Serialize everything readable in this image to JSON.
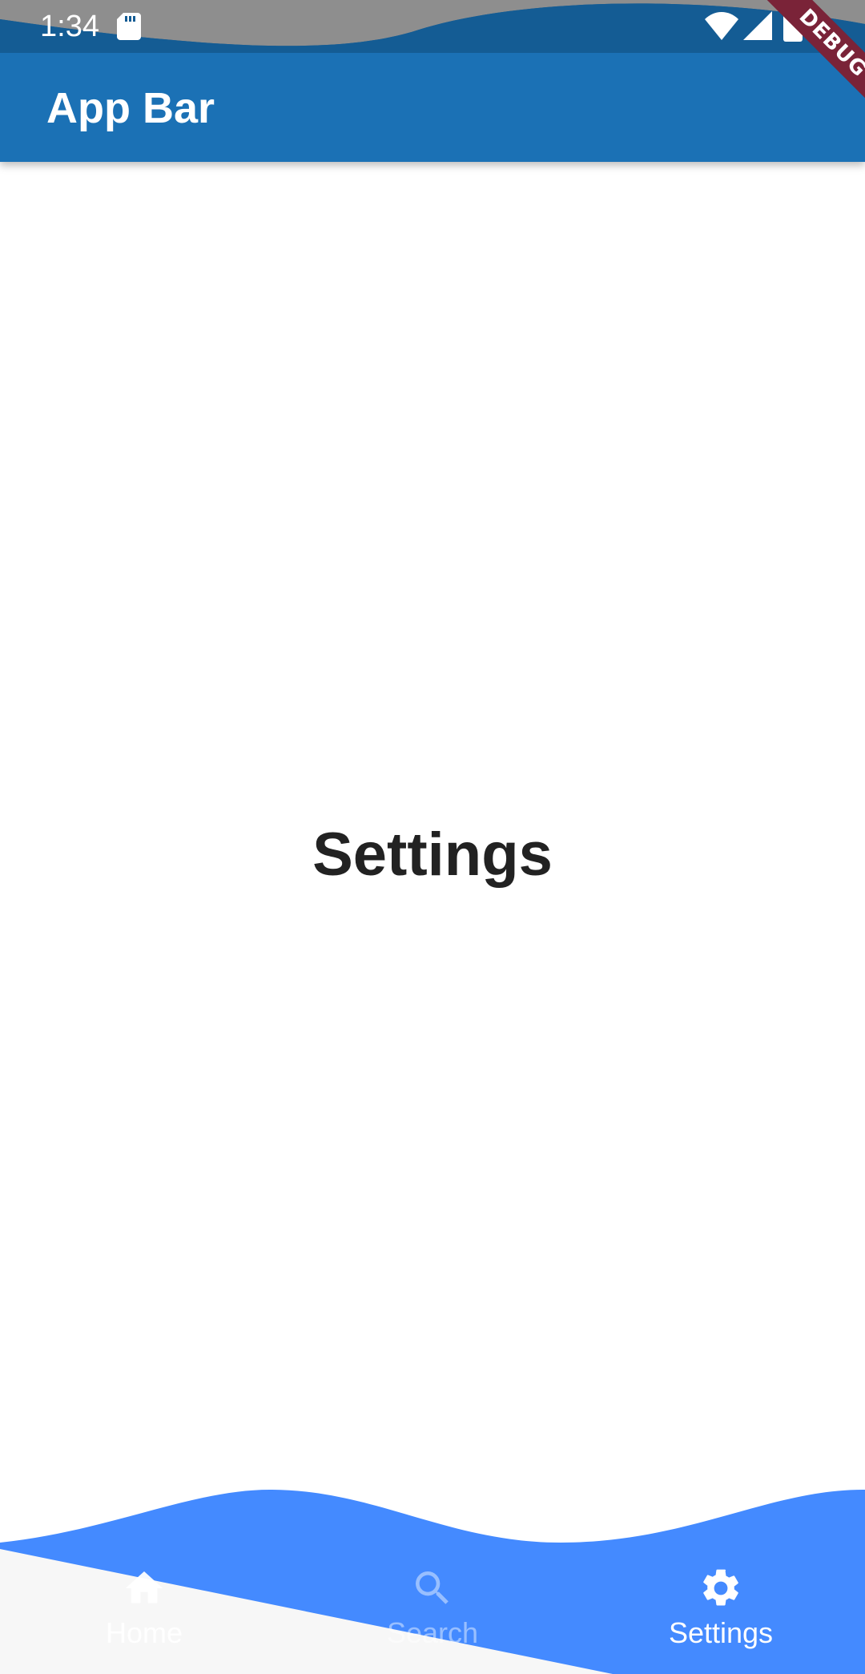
{
  "status_bar": {
    "time": "1:34",
    "icons": [
      "sd-card-icon",
      "wifi-icon",
      "signal-icon",
      "battery-icon"
    ]
  },
  "debug_banner": {
    "label": "DEBUG"
  },
  "app_bar": {
    "title": "App Bar"
  },
  "main": {
    "heading": "Settings"
  },
  "bottom_nav": {
    "items": [
      {
        "label": "Home",
        "icon": "home-icon",
        "active": false
      },
      {
        "label": "Search",
        "icon": "search-icon",
        "active": false
      },
      {
        "label": "Settings",
        "icon": "gear-icon",
        "active": true
      }
    ]
  },
  "colors": {
    "status_bar": "#145c94",
    "app_bar": "#1b71b5",
    "nav_blue": "#448aff",
    "debug_ribbon": "#7a2338",
    "nav_light": "#f7f7f7",
    "heading_text": "#222222"
  }
}
